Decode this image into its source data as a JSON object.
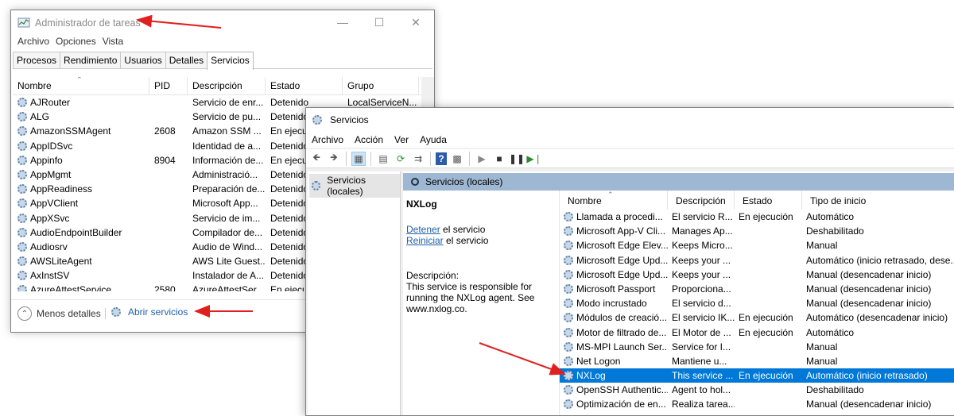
{
  "taskmanager": {
    "title": "Administrador de tareas",
    "menu": [
      "Archivo",
      "Opciones",
      "Vista"
    ],
    "tabs": [
      "Procesos",
      "Rendimiento",
      "Usuarios",
      "Detalles",
      "Servicios"
    ],
    "active_tab": "Servicios",
    "columns": [
      "Nombre",
      "PID",
      "Descripción",
      "Estado",
      "Grupo"
    ],
    "rows": [
      [
        "AJRouter",
        "",
        "Servicio de enr...",
        "Detenido",
        "LocalServiceN..."
      ],
      [
        "ALG",
        "",
        "Servicio de pu...",
        "Detenido",
        ""
      ],
      [
        "AmazonSSMAgent",
        "2608",
        "Amazon SSM ...",
        "En ejecu",
        ""
      ],
      [
        "AppIDSvc",
        "",
        "Identidad de a...",
        "Detenido",
        ""
      ],
      [
        "Appinfo",
        "8904",
        "Información de...",
        "En ejecu",
        ""
      ],
      [
        "AppMgmt",
        "",
        "Administració...",
        "Detenido",
        ""
      ],
      [
        "AppReadiness",
        "",
        "Preparación de...",
        "Detenido",
        ""
      ],
      [
        "AppVClient",
        "",
        "Microsoft App...",
        "Detenido",
        ""
      ],
      [
        "AppXSvc",
        "",
        "Servicio de im...",
        "Detenido",
        ""
      ],
      [
        "AudioEndpointBuilder",
        "",
        "Compilador de...",
        "Detenido",
        ""
      ],
      [
        "Audiosrv",
        "",
        "Audio de Wind...",
        "Detenido",
        ""
      ],
      [
        "AWSLiteAgent",
        "",
        "AWS Lite Guest...",
        "Detenido",
        ""
      ],
      [
        "AxInstSV",
        "",
        "Instalador de A...",
        "Detenido",
        ""
      ],
      [
        "AzureAttestService",
        "2580",
        "AzureAttestSer...",
        "En ejecu",
        ""
      ]
    ],
    "footer": {
      "less_details": "Menos detalles",
      "open_services": "Abrir servicios"
    }
  },
  "services": {
    "title": "Servicios",
    "menu": [
      "Archivo",
      "Acción",
      "Ver",
      "Ayuda"
    ],
    "tree_node": "Servicios (locales)",
    "pane_header": "Servicios (locales)",
    "detail": {
      "name": "NXLog",
      "stop_link": "Detener",
      "stop_suffix": " el servicio",
      "restart_link": "Reiniciar",
      "restart_suffix": " el servicio",
      "desc_label": "Descripción:",
      "desc_text": "This service is responsible for running the NXLog agent. See www.nxlog.co."
    },
    "columns": [
      "Nombre",
      "Descripción",
      "Estado",
      "Tipo de inicio"
    ],
    "selected_row": 11,
    "rows": [
      [
        "Llamada a procedi...",
        "El servicio R...",
        "En ejecución",
        "Automático"
      ],
      [
        "Microsoft App-V Cli...",
        "Manages Ap...",
        "",
        "Deshabilitado"
      ],
      [
        "Microsoft Edge Elev...",
        "Keeps Micro...",
        "",
        "Manual"
      ],
      [
        "Microsoft Edge Upd...",
        "Keeps your ...",
        "",
        "Automático (inicio retrasado, dese..."
      ],
      [
        "Microsoft Edge Upd...",
        "Keeps your ...",
        "",
        "Manual (desencadenar inicio)"
      ],
      [
        "Microsoft Passport",
        "Proporciona...",
        "",
        "Manual (desencadenar inicio)"
      ],
      [
        "Modo incrustado",
        "El servicio d...",
        "",
        "Manual (desencadenar inicio)"
      ],
      [
        "Módulos de creació...",
        "El servicio IK...",
        "En ejecución",
        "Automático (desencadenar inicio)"
      ],
      [
        "Motor de filtrado de...",
        "El Motor de ...",
        "En ejecución",
        "Automático"
      ],
      [
        "MS-MPI Launch Ser...",
        "Service for I...",
        "",
        "Manual"
      ],
      [
        "Net Logon",
        "Mantiene u...",
        "",
        "Manual"
      ],
      [
        "NXLog",
        "This service ...",
        "En ejecución",
        "Automático (inicio retrasado)"
      ],
      [
        "OpenSSH Authentic...",
        "Agent to hol...",
        "",
        "Deshabilitado"
      ],
      [
        "Optimización de en...",
        "Realiza tarea...",
        "",
        "Manual (desencadenar inicio)"
      ]
    ]
  },
  "annotation_color": "#e02020",
  "selection_color": "#0078d7"
}
